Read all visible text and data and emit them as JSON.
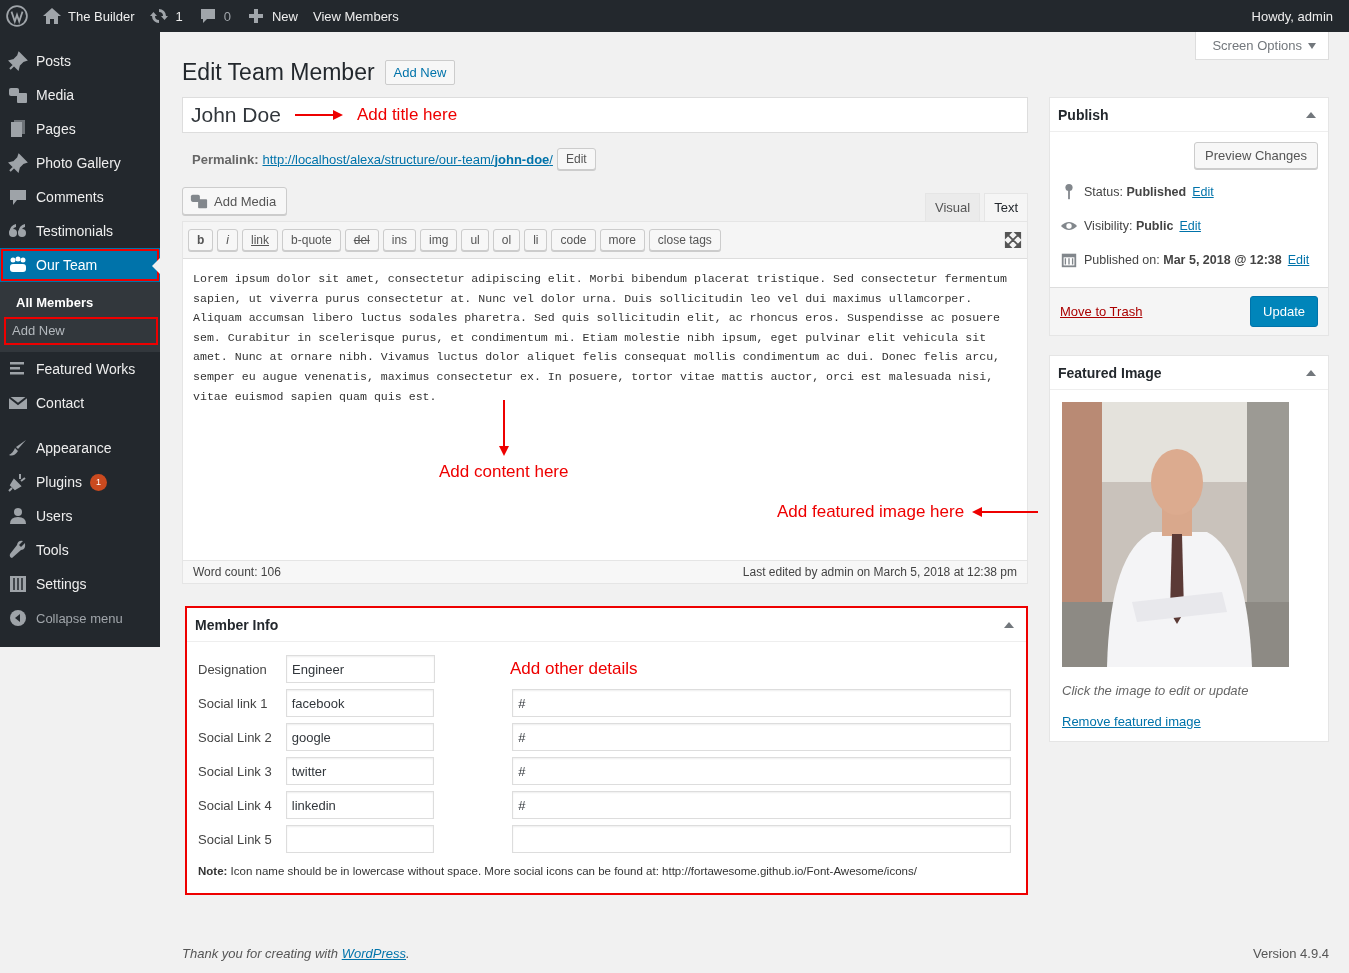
{
  "admin_bar": {
    "items": [
      {
        "kind": "logo"
      },
      {
        "kind": "home",
        "label": "The Builder"
      },
      {
        "kind": "updates",
        "label": "1"
      },
      {
        "kind": "comments",
        "label": "0"
      },
      {
        "kind": "new",
        "label": "New"
      },
      {
        "kind": "link",
        "label": "View Members"
      }
    ],
    "greeting": "Howdy, admin"
  },
  "sidebar": {
    "items": [
      {
        "kind": "item",
        "label": "Posts",
        "selected": false,
        "highlighted": false
      },
      {
        "kind": "item",
        "label": "Media",
        "selected": false,
        "highlighted": false
      },
      {
        "kind": "item",
        "label": "Pages",
        "selected": false,
        "highlighted": false
      },
      {
        "kind": "item",
        "label": "Photo Gallery",
        "selected": false,
        "highlighted": false
      },
      {
        "kind": "item",
        "label": "Comments",
        "selected": false,
        "highlighted": false
      },
      {
        "kind": "item",
        "label": "Testimonials",
        "selected": false,
        "highlighted": false
      },
      {
        "kind": "item",
        "label": "Our Team",
        "selected": true,
        "highlighted": true,
        "submenu": [
          {
            "label": "All Members",
            "selected": true,
            "highlighted": false
          },
          {
            "label": "Add New",
            "selected": false,
            "highlighted": true
          }
        ]
      },
      {
        "kind": "item",
        "label": "Featured Works",
        "selected": false,
        "highlighted": false
      },
      {
        "kind": "item",
        "label": "Contact",
        "selected": false,
        "highlighted": false
      },
      {
        "kind": "separator"
      },
      {
        "kind": "item",
        "label": "Appearance",
        "selected": false,
        "highlighted": false
      },
      {
        "kind": "item",
        "label": "Plugins",
        "selected": false,
        "highlighted": false,
        "badge": "1"
      },
      {
        "kind": "item",
        "label": "Users",
        "selected": false,
        "highlighted": false
      },
      {
        "kind": "item",
        "label": "Tools",
        "selected": false,
        "highlighted": false
      },
      {
        "kind": "item",
        "label": "Settings",
        "selected": false,
        "highlighted": false
      },
      {
        "kind": "collapse",
        "label": "Collapse menu",
        "selected": false,
        "highlighted": false
      }
    ]
  },
  "screen_options": "Screen Options",
  "heading": "Edit Team Member",
  "add_new": "Add New",
  "post_title": {
    "value": "John Doe",
    "annotation": "Add title here"
  },
  "permalink": {
    "label": "Permalink:",
    "url": "http://localhost/alexa/structure/our-team/**john-doe**/",
    "edit": "Edit"
  },
  "editor": {
    "add_media": "Add Media",
    "tabs": [
      {
        "label": "Visual",
        "selected": false
      },
      {
        "label": "Text",
        "selected": true
      }
    ],
    "quicktags": [
      {
        "label": "b",
        "kind": "bold"
      },
      {
        "label": "i",
        "kind": "italic"
      },
      {
        "label": "link",
        "kind": "underline"
      },
      {
        "label": "b-quote",
        "kind": "plain"
      },
      {
        "label": "del",
        "kind": "strike"
      },
      {
        "label": "ins",
        "kind": "plain"
      },
      {
        "label": "img",
        "kind": "plain"
      },
      {
        "label": "ul",
        "kind": "plain"
      },
      {
        "label": "ol",
        "kind": "plain"
      },
      {
        "label": "li",
        "kind": "plain"
      },
      {
        "label": "code",
        "kind": "plain"
      },
      {
        "label": "more",
        "kind": "plain"
      },
      {
        "label": "close tags",
        "kind": "plain"
      }
    ],
    "content": "Lorem ipsum dolor sit amet, consectetur adipiscing elit. Morbi bibendum placerat tristique. Sed consectetur fermentum sapien, ut viverra purus consectetur at. Nunc vel dolor urna. Duis sollicitudin leo vel dui maximus ullamcorper. Aliquam accumsan libero luctus sodales pharetra. Sed quis sollicitudin elit, ac rhoncus eros. Suspendisse ac posuere sem. Curabitur in scelerisque purus, et condimentum mi. Etiam molestie nibh ipsum, eget pulvinar elit vehicula sit amet. Nunc at ornare nibh. Vivamus luctus dolor aliquet felis consequat mollis condimentum ac dui. Donec felis arcu, semper eu augue venenatis, maximus consectetur ex. In posuere, tortor vitae mattis auctor, orci est malesuada nisi, vitae euismod sapien quam quis est.",
    "annotations": [
      {
        "kind": "down",
        "text": "Add content here"
      },
      {
        "kind": "left",
        "text": "Add featured image here"
      }
    ],
    "word_count": "Word count: 106",
    "last_edited": "Last edited by admin on March 5, 2018 at 12:38 pm"
  },
  "member_info": {
    "title": "Member Info",
    "highlighted": true,
    "annotation": "Add other details",
    "rows": [
      {
        "label": "Designation",
        "value": "Engineer"
      },
      {
        "label": "Social link 1",
        "value": "facebook",
        "link": "#"
      },
      {
        "label": "Social Link 2",
        "value": "google",
        "link": "#"
      },
      {
        "label": "Social Link 3",
        "value": "twitter",
        "link": "#"
      },
      {
        "label": "Social Link 4",
        "value": "linkedin",
        "link": "#"
      },
      {
        "label": "Social Link 5",
        "kind": "empty"
      }
    ],
    "note": "**Note:** Icon name should be in lowercase without space. More social icons can be found at: http://fortawesome.github.io/Font-Awesome/icons/"
  },
  "publish": {
    "title": "Publish",
    "preview": "Preview Changes",
    "rows": [
      {
        "kind": "status",
        "label": "Status:",
        "value": "Published",
        "link": "Edit"
      },
      {
        "kind": "visibility",
        "label": "Visibility:",
        "value": "Public",
        "link": "Edit"
      },
      {
        "kind": "date",
        "label": "Published on:",
        "value": "Mar 5, 2018 @ 12:38",
        "link": "Edit"
      }
    ],
    "trash": "Move to Trash",
    "update": "Update"
  },
  "featured_image": {
    "title": "Featured Image",
    "caption": "Click the image to edit or update",
    "remove": "Remove featured image"
  },
  "footer": {
    "text": "Thank you for creating with ",
    "link": "WordPress",
    "after": ".",
    "version": "Version 4.9.4"
  }
}
